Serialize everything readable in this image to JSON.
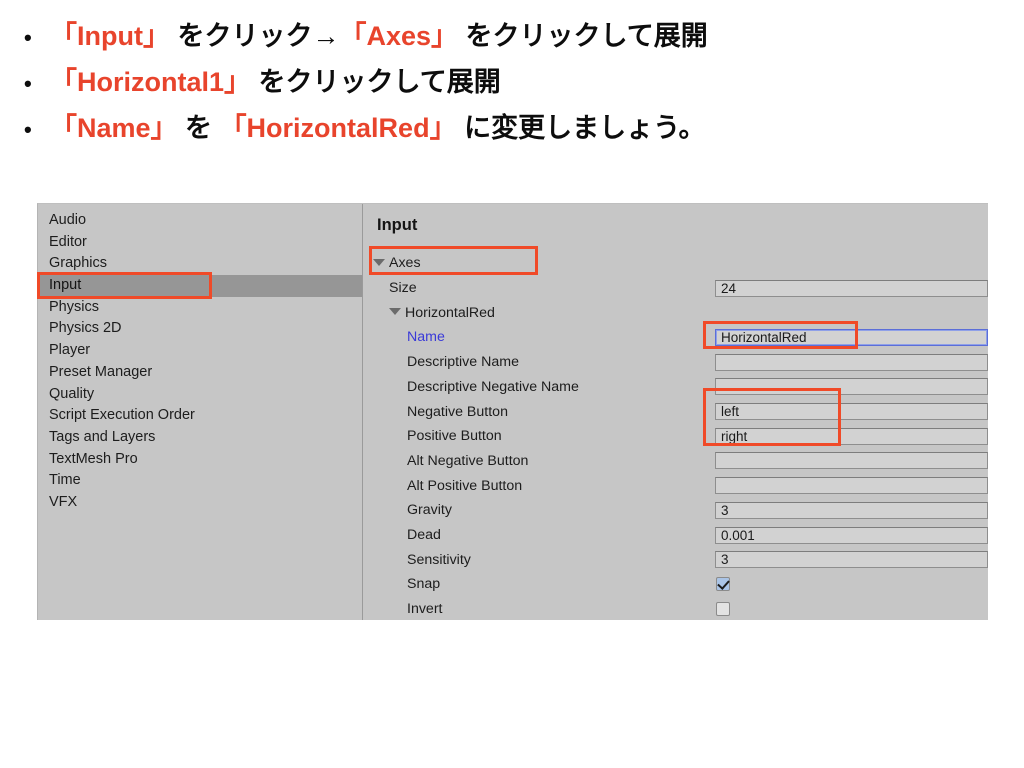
{
  "slide": {
    "bullets": [
      {
        "marker": "•",
        "segments": [
          {
            "text": "「Input」",
            "color": "red"
          },
          {
            "text": " をクリック→",
            "color": "black"
          },
          {
            "text": "「Axes」",
            "color": "red"
          },
          {
            "text": " をクリックして展開",
            "color": "black"
          }
        ]
      },
      {
        "marker": "•",
        "segments": [
          {
            "text": "「Horizontal1」",
            "color": "red"
          },
          {
            "text": " をクリックして展開",
            "color": "black"
          }
        ]
      },
      {
        "marker": "•",
        "segments": [
          {
            "text": "「Name」",
            "color": "red"
          },
          {
            "text": " を ",
            "color": "black"
          },
          {
            "text": "「HorizontalRed」",
            "color": "red"
          },
          {
            "text": " に変更しましょう。",
            "color": "black"
          }
        ]
      }
    ]
  },
  "colors": {
    "annotation_red": "#f04a28",
    "bullet_red": "#e8442c",
    "panel_bg": "#c6c6c6",
    "selected_row": "#969696",
    "focus_blue": "#5b6ed8",
    "checkbox_blue": "#aac4e6"
  },
  "settings_window": {
    "sidebar": {
      "items": [
        {
          "label": "Audio",
          "selected": false
        },
        {
          "label": "Editor",
          "selected": false
        },
        {
          "label": "Graphics",
          "selected": false
        },
        {
          "label": "Input",
          "selected": true
        },
        {
          "label": "Physics",
          "selected": false
        },
        {
          "label": "Physics 2D",
          "selected": false
        },
        {
          "label": "Player",
          "selected": false
        },
        {
          "label": "Preset Manager",
          "selected": false
        },
        {
          "label": "Quality",
          "selected": false
        },
        {
          "label": "Script Execution Order",
          "selected": false
        },
        {
          "label": "Tags and Layers",
          "selected": false
        },
        {
          "label": "TextMesh Pro",
          "selected": false
        },
        {
          "label": "Time",
          "selected": false
        },
        {
          "label": "VFX",
          "selected": false
        }
      ]
    },
    "detail": {
      "title": "Input",
      "rows": [
        {
          "label": "Axes",
          "indent": 0,
          "type": "foldout",
          "expanded": true,
          "value": ""
        },
        {
          "label": "Size",
          "indent": 1,
          "type": "text",
          "value": "24"
        },
        {
          "label": "HorizontalRed",
          "indent": 1,
          "type": "foldout",
          "expanded": true,
          "value": ""
        },
        {
          "label": "Name",
          "indent": 2,
          "type": "text",
          "value": "HorizontalRed",
          "focused": true,
          "label_blue": true
        },
        {
          "label": "Descriptive Name",
          "indent": 2,
          "type": "text",
          "value": ""
        },
        {
          "label": "Descriptive Negative Name",
          "indent": 2,
          "type": "text",
          "value": ""
        },
        {
          "label": "Negative Button",
          "indent": 2,
          "type": "text",
          "value": "left"
        },
        {
          "label": "Positive Button",
          "indent": 2,
          "type": "text",
          "value": "right"
        },
        {
          "label": "Alt Negative Button",
          "indent": 2,
          "type": "text",
          "value": ""
        },
        {
          "label": "Alt Positive Button",
          "indent": 2,
          "type": "text",
          "value": ""
        },
        {
          "label": "Gravity",
          "indent": 2,
          "type": "text",
          "value": "3"
        },
        {
          "label": "Dead",
          "indent": 2,
          "type": "text",
          "value": "0.001"
        },
        {
          "label": "Sensitivity",
          "indent": 2,
          "type": "text",
          "value": "3"
        },
        {
          "label": "Snap",
          "indent": 2,
          "type": "checkbox",
          "checked": true,
          "value": ""
        },
        {
          "label": "Invert",
          "indent": 2,
          "type": "checkbox",
          "checked": false,
          "value": ""
        }
      ]
    }
  }
}
